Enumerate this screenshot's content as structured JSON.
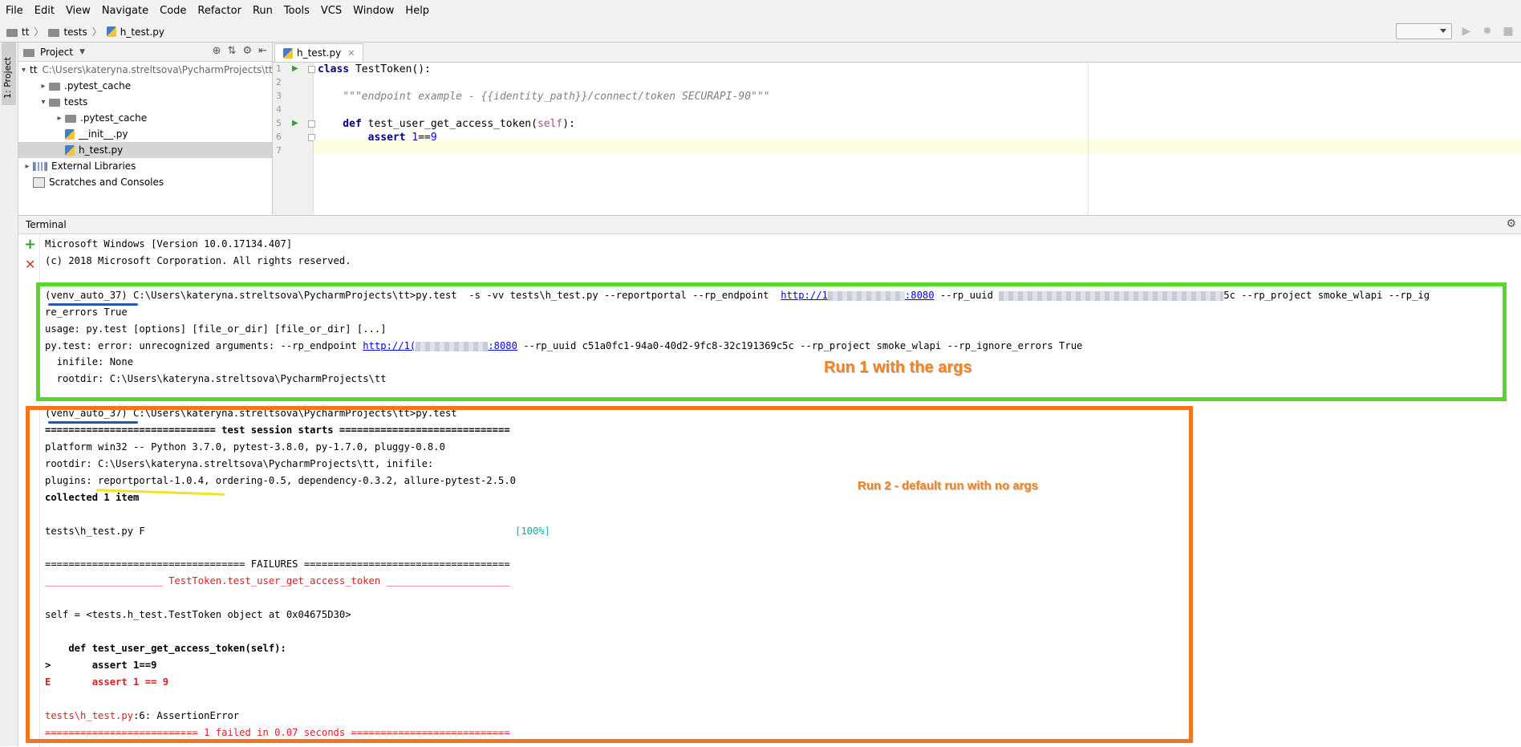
{
  "menu": [
    "File",
    "Edit",
    "View",
    "Navigate",
    "Code",
    "Refactor",
    "Run",
    "Tools",
    "VCS",
    "Window",
    "Help"
  ],
  "breadcrumb": [
    "tt",
    "tests",
    "h_test.py"
  ],
  "project": {
    "title": "Project",
    "tree": [
      {
        "label": "tt",
        "hint": "C:\\Users\\kateryna.streltsova\\PycharmProjects\\tt",
        "type": "folder",
        "level": 0,
        "expanded": true
      },
      {
        "label": ".pytest_cache",
        "type": "folder",
        "level": 1,
        "expanded": false
      },
      {
        "label": "tests",
        "type": "folder",
        "level": 1,
        "expanded": true
      },
      {
        "label": ".pytest_cache",
        "type": "folder",
        "level": 2,
        "expanded": false
      },
      {
        "label": "__init__.py",
        "type": "py",
        "level": 2
      },
      {
        "label": "h_test.py",
        "type": "py",
        "level": 2,
        "selected": true
      },
      {
        "label": "External Libraries",
        "type": "lib",
        "level": 0,
        "expanded": false
      },
      {
        "label": "Scratches and Consoles",
        "type": "scratch",
        "level": 0
      }
    ]
  },
  "editor": {
    "tab": "h_test.py",
    "line_numbers": [
      "1",
      "2",
      "3",
      "4",
      "5",
      "6",
      "7"
    ],
    "code": {
      "l1_kw": "class",
      "l1_rest": " TestToken():",
      "l3": "    \"\"\"endpoint example - {{identity_path}}/connect/token SECURAPI-90\"\"\"",
      "l5_kw": "    def",
      "l5_name": " test_user_get_access_token(",
      "l5_self": "self",
      "l5_end": "):",
      "l6_kw": "        assert",
      "l6_num": " 1",
      "l6_op": "==",
      "l6_num2": "9"
    }
  },
  "terminal": {
    "title": "Terminal",
    "lines": {
      "win_version": "Microsoft Windows [Version 10.0.17134.407]",
      "copyright": "(c) 2018 Microsoft Corporation. All rights reserved.",
      "run1_prompt": "(venv_auto_37) C:\\Users\\kateryna.streltsova\\PycharmProjects\\tt>py.test  -s -vv tests\\h_test.py --reportportal --rp_endpoint  ",
      "run1_url_a": "http://1",
      "run1_url_b": ":8080",
      "run1_uuid": " --rp_uuid ",
      "run1_uuid_end": "5c --rp_project smoke_wlapi --rp_ig",
      "run1_wrap": "re_errors True",
      "usage": "usage: py.test [options] [file_or_dir] [file_or_dir] [...]",
      "error_a": "py.test: error: unrecognized arguments: --rp_endpoint ",
      "error_url_a": "http://1(",
      "error_url_b": ":8080",
      "error_b": " --rp_uuid c51a0fc1-94a0-40d2-9fc8-32c191369c5c --rp_project smoke_wlapi --rp_ignore_errors True",
      "inifile": "  inifile: None",
      "rootdir1": "  rootdir: C:\\Users\\kateryna.streltsova\\PycharmProjects\\tt",
      "run2_prompt": "(venv_auto_37) C:\\Users\\kateryna.streltsova\\PycharmProjects\\tt>py.test",
      "session": "============================= test session starts =============================",
      "platform": "platform win32 -- Python 3.7.0, pytest-3.8.0, py-1.7.0, pluggy-0.8.0",
      "rootdir2": "rootdir: C:\\Users\\kateryna.streltsova\\PycharmProjects\\tt, inifile:",
      "plugins": "plugins: reportportal-1.0.4, ordering-0.5, dependency-0.3.2, allure-pytest-2.5.0",
      "collected": "collected 1 item",
      "result_file": "tests\\h_test.py F",
      "result_pct": "[100%]",
      "failures": "================================== FAILURES ===================================",
      "failname": "____________________ TestToken.test_user_get_access_token _____________________",
      "selfline": "self = <tests.h_test.TestToken object at 0x04675D30>",
      "defline": "    def test_user_get_access_token(self):",
      "assertline": ">       assert 1==9",
      "eline": "E       assert 1 == 9",
      "tb_file": "tests\\h_test.py",
      "tb_rest": ":6: AssertionError",
      "summary": "========================== 1 failed in 0.07 seconds ==========================="
    }
  },
  "annotations": {
    "run1": "Run 1 with the args",
    "run2": "Run 2 - default run with no args"
  },
  "sidebar_tab": "1: Project",
  "colors": {
    "green_box": "#58d62b",
    "orange_box": "#f2751f",
    "annotation": "#f2851f"
  }
}
